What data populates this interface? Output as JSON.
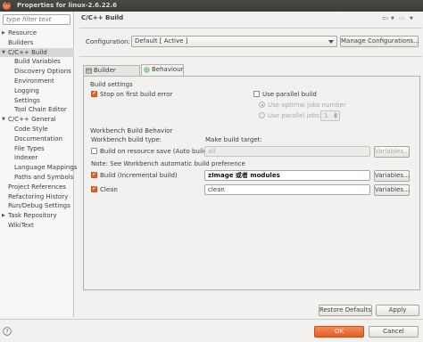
{
  "window": {
    "title": "Properties for linux-2.6.22.6"
  },
  "sidebar": {
    "filter_placeholder": "type filter text",
    "items": [
      {
        "label": "Resource",
        "level": 1,
        "expandable": true
      },
      {
        "label": "Builders",
        "level": 1,
        "expandable": false
      },
      {
        "label": "C/C++ Build",
        "level": 1,
        "expandable": true,
        "expanded": true,
        "selected": true
      },
      {
        "label": "Build Variables",
        "level": 2
      },
      {
        "label": "Discovery Options",
        "level": 2
      },
      {
        "label": "Environment",
        "level": 2
      },
      {
        "label": "Logging",
        "level": 2
      },
      {
        "label": "Settings",
        "level": 2
      },
      {
        "label": "Tool Chain Editor",
        "level": 2
      },
      {
        "label": "C/C++ General",
        "level": 1,
        "expandable": true,
        "expanded": true
      },
      {
        "label": "Code Style",
        "level": 2
      },
      {
        "label": "Documentation",
        "level": 2
      },
      {
        "label": "File Types",
        "level": 2
      },
      {
        "label": "Indexer",
        "level": 2
      },
      {
        "label": "Language Mappings",
        "level": 2
      },
      {
        "label": "Paths and Symbols",
        "level": 2
      },
      {
        "label": "Project References",
        "level": 1
      },
      {
        "label": "Refactoring History",
        "level": 1
      },
      {
        "label": "Run/Debug Settings",
        "level": 1
      },
      {
        "label": "Task Repository",
        "level": 1,
        "expandable": true
      },
      {
        "label": "WikiText",
        "level": 1
      }
    ]
  },
  "header": {
    "title": "C/C++ Build"
  },
  "configuration": {
    "label": "Configuration:",
    "value": "Default  [ Active ]",
    "manage_button": "Manage Configurations..."
  },
  "tabs": [
    {
      "label": "Builder Settings",
      "active": false
    },
    {
      "label": "Behaviour",
      "active": true
    }
  ],
  "build_settings": {
    "group_title": "Build settings",
    "stop_on_first_error": {
      "label": "Stop on first build error",
      "checked": true
    },
    "use_parallel_build": {
      "label": "Use parallel build",
      "checked": false
    },
    "use_optimal_jobs": {
      "label": "Use optimal jobs number",
      "selected": true,
      "enabled": false
    },
    "use_parallel_jobs": {
      "label": "Use parallel jobs:",
      "selected": false,
      "enabled": false,
      "value": "1"
    }
  },
  "workbench": {
    "group_title": "Workbench Build Behavior",
    "col_build_type": "Workbench build type:",
    "col_make_target": "Make build target:",
    "rows": [
      {
        "name": "auto",
        "label": "Build on resource save (Auto build)",
        "checked": false,
        "target": "all",
        "enabled": false,
        "variables": "Variables..."
      },
      {
        "name": "note",
        "label": "Note: See Workbench automatic build preference"
      },
      {
        "name": "incremental",
        "label": "Build (Incremental build)",
        "checked": true,
        "target": "zImage 或者 modules",
        "enabled": true,
        "variables": "Variables..."
      },
      {
        "name": "clean",
        "label": "Clean",
        "checked": true,
        "target": "clean",
        "enabled": true,
        "variables": "Variables..."
      }
    ]
  },
  "footer": {
    "restore_defaults": "Restore Defaults",
    "apply": "Apply",
    "ok": "OK",
    "cancel": "Cancel"
  },
  "colors": {
    "accent": "#e9632b",
    "titlebar": "#3c3b37",
    "background": "#f2f1f0"
  }
}
